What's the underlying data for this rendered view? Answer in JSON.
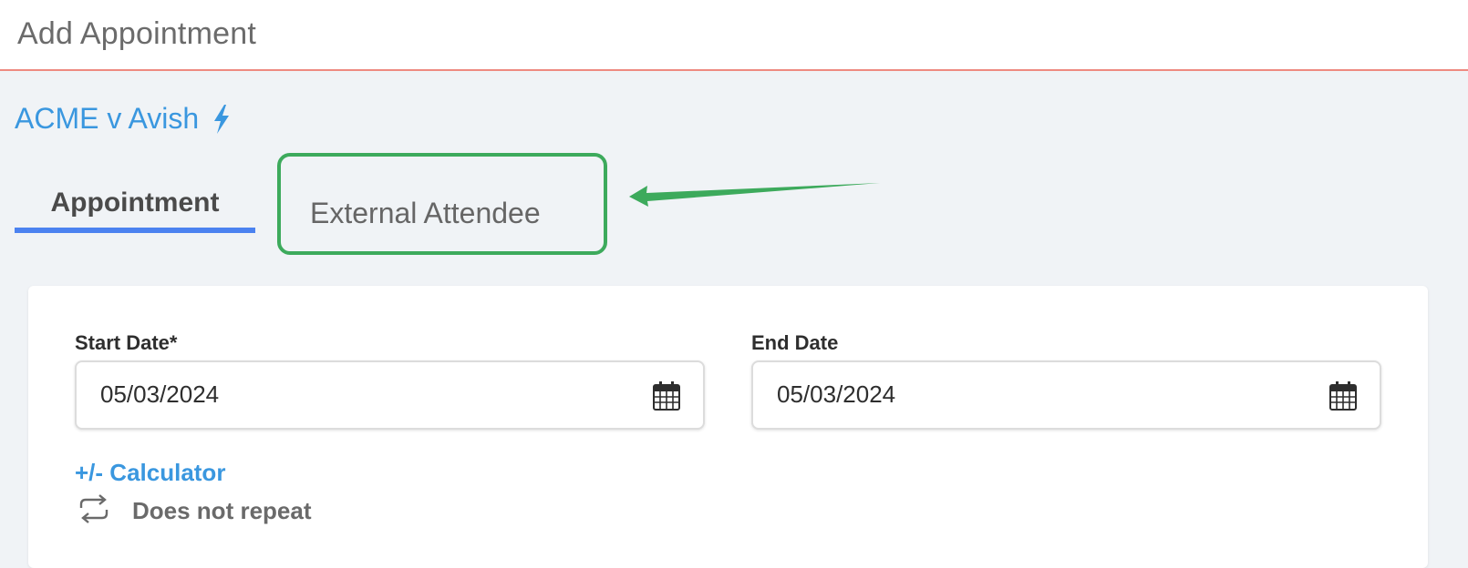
{
  "header": {
    "title": "Add Appointment"
  },
  "matter": {
    "link_text": "ACME v Avish",
    "icon": "bolt-icon"
  },
  "tabs": [
    {
      "label": "Appointment",
      "active": true
    },
    {
      "label": "External Attendee",
      "active": false,
      "highlighted": true
    }
  ],
  "form": {
    "start_date": {
      "label": "Start Date*",
      "value": "05/03/2024",
      "icon": "calendar-icon"
    },
    "end_date": {
      "label": "End Date",
      "value": "05/03/2024",
      "icon": "calendar-icon"
    },
    "calculator_link": "+/- Calculator",
    "recurrence": {
      "icon": "repeat-icon",
      "label": "Does not repeat"
    }
  },
  "colors": {
    "accent_blue": "#3a97df",
    "tab_underline": "#4b82f0",
    "highlight_green": "#3daa5c",
    "header_border": "#ee8a80",
    "background": "#f0f3f6"
  }
}
